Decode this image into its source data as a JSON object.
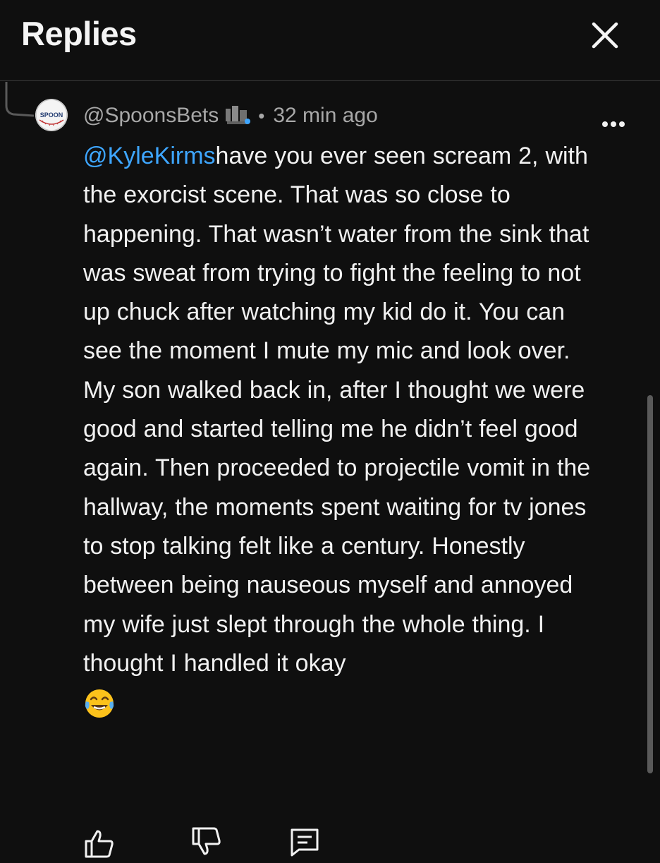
{
  "header": {
    "title": "Replies",
    "close_icon": "close-icon"
  },
  "reply": {
    "handle": "@SpoonsBets",
    "separator": "•",
    "timestamp": "32 min ago",
    "avatar_text": "SPOON",
    "mention": "@KyleKirms",
    "body": "have you ever seen scream 2, with the exorcist scene. That was so close to happening.  That wasn’t water from the sink that was sweat from trying to fight the feeling to not up chuck after watching my kid do it. You can see the moment I mute my mic and look over. My son walked back in, after I thought we were good and started telling me he didn’t feel good again. Then proceeded to projectile vomit in the hallway, the moments spent waiting for tv jones to stop talking felt like a century. Honestly between being nauseous myself and annoyed my wife just slept through the whole thing. I thought I handled it okay",
    "emoji": "face-with-tears-of-joy",
    "more_icon": "more-options-icon"
  },
  "actions": {
    "like_icon": "thumbs-up-icon",
    "dislike_icon": "thumbs-down-icon",
    "reply_icon": "reply-comment-icon"
  },
  "colors": {
    "background": "#0f0f0f",
    "text": "#f1f1f1",
    "secondary_text": "#a8a8a8",
    "mention": "#3ea6ff",
    "divider": "#3a3a3a"
  }
}
